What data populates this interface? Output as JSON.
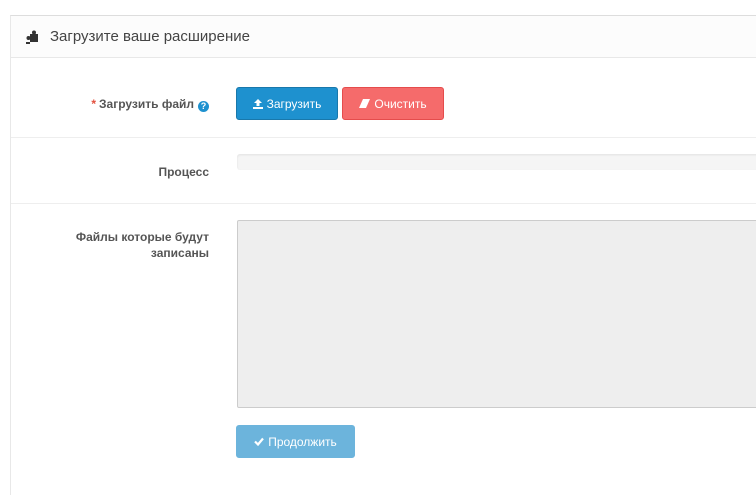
{
  "panel": {
    "title": "Загрузите ваше расширение",
    "icon": "puzzle-icon"
  },
  "upload_row": {
    "required_mark": "*",
    "label": "Загрузить файл",
    "help_icon": "question-circle-icon",
    "help_glyph": "?",
    "upload_button_label": "Загрузить",
    "upload_icon": "upload-icon",
    "clear_button_label": "Очистить",
    "clear_icon": "eraser-icon"
  },
  "progress_row": {
    "label": "Процесс",
    "progress_percent": 0
  },
  "files_row": {
    "label_line1": "Файлы которые будут",
    "label_line2": "записаны",
    "files_text": "",
    "continue_button_label": "Продолжить",
    "continue_icon": "check-icon"
  },
  "colors": {
    "primary": "#1e91cf",
    "danger": "#f56b6b",
    "required": "#e3503e",
    "disabled_primary": "#6cb4dc"
  }
}
